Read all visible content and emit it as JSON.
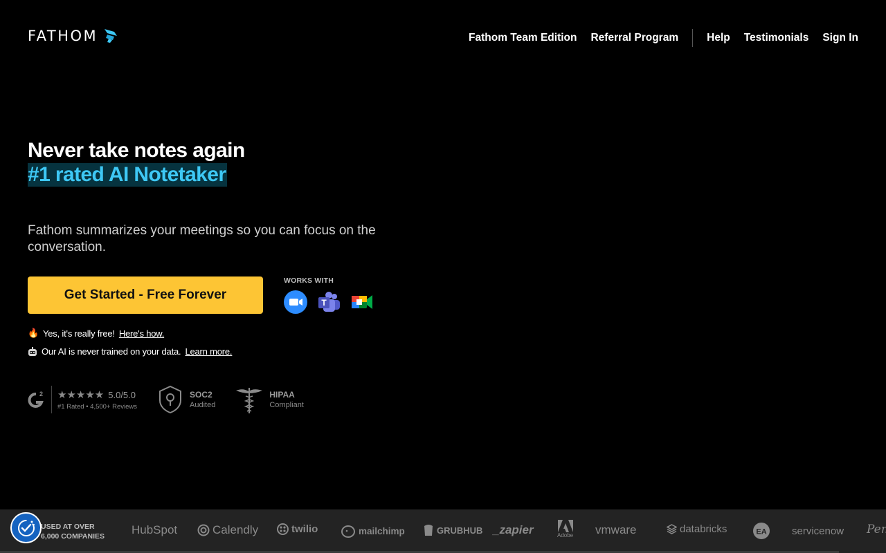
{
  "header": {
    "logo_text": "FATHOM",
    "nav": [
      {
        "label": "Fathom Team Edition"
      },
      {
        "label": "Referral Program"
      },
      {
        "label": "Help"
      },
      {
        "label": "Testimonials"
      },
      {
        "label": "Sign In"
      }
    ]
  },
  "hero": {
    "headline": "Never take notes again",
    "highlight": "#1 rated AI Notetaker",
    "subtitle": "Fathom summarizes your meetings so you can focus on the conversation.",
    "cta_label": "Get Started - Free Forever",
    "works_with_label": "WORKS WITH",
    "works_with_icons": [
      "zoom-icon",
      "teams-icon",
      "google-meet-icon"
    ],
    "note1_text": "Yes, it's really free!",
    "note1_link": "Here's how.",
    "note2_text": "Our AI is never trained on your data.",
    "note2_link": "Learn more."
  },
  "badges": {
    "g2_rating": "5.0/5.0",
    "g2_sub": "#1 Rated • 4,500+ Reviews",
    "soc2_title": "SOC2",
    "soc2_sub": "Audited",
    "hipaa_title": "HIPAA",
    "hipaa_sub": "Compliant"
  },
  "strip": {
    "used_line1": "USED AT OVER",
    "used_line2": "6,000 COMPANIES",
    "companies": {
      "hubspot": "HubSpot",
      "calendly": "Calendly",
      "twilio": "twilio",
      "mailchimp": "mailchimp",
      "grubhub": "GRUBHUB",
      "zapier": "_zapier",
      "adobe": "Adobe",
      "vmware": "vmware",
      "databricks": "databricks",
      "ea": "EA",
      "servicenow": "servicenow",
      "pendo": "Pen"
    }
  },
  "colors": {
    "accent_blue": "#3ec8f5",
    "cta_yellow": "#fdc534",
    "background": "#000000"
  }
}
